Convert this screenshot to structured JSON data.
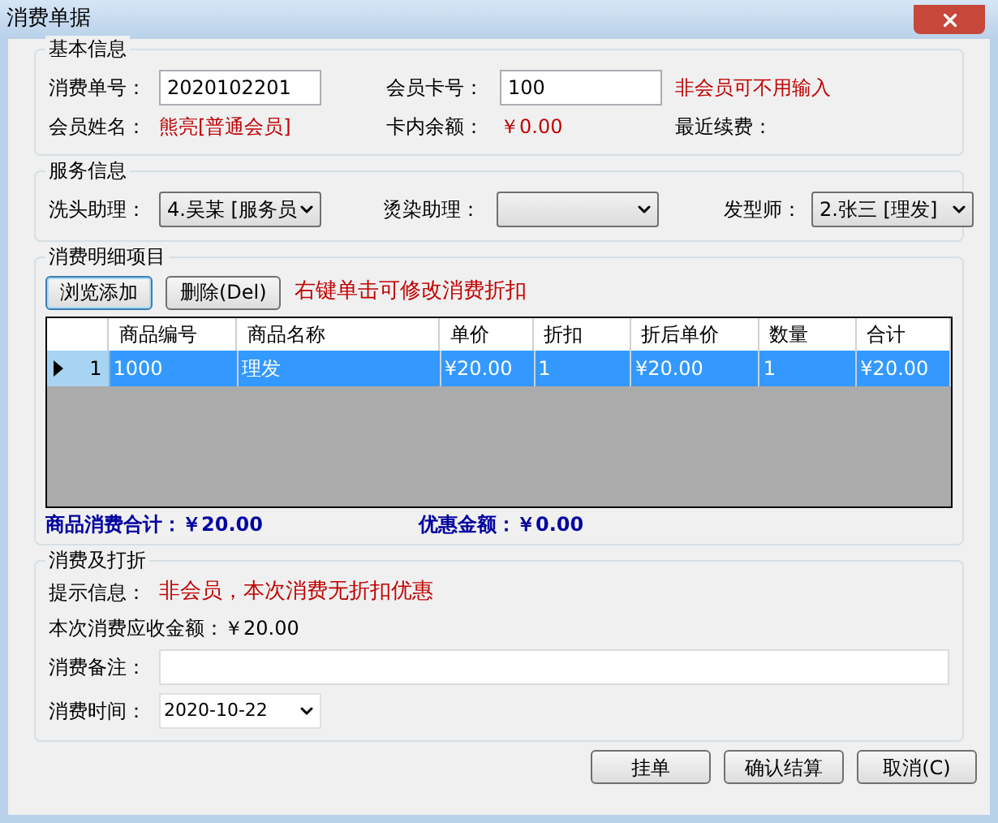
{
  "window": {
    "title": "消费单据"
  },
  "basic_info": {
    "title": "基本信息",
    "order_no": {
      "label": "消费单号：",
      "value": "2020102201"
    },
    "card_no": {
      "label": "会员卡号：",
      "value": "100"
    },
    "card_hint": "非会员可不用输入",
    "member_name": {
      "label": "会员姓名：",
      "value": "熊亮[普通会员]"
    },
    "balance": {
      "label": "卡内余额：",
      "value": "￥0.00"
    },
    "recent_renewal": {
      "label": "最近续费："
    }
  },
  "service_info": {
    "title": "服务信息",
    "selects": [
      {
        "label": "洗头助理：",
        "value": "4.吴某 [服务员"
      },
      {
        "label": "烫染助理："
      },
      {
        "label": "发型师：",
        "value": "2.张三 [理发]"
      }
    ]
  },
  "details": {
    "title": "消费明细项目",
    "buttons": [
      {
        "label": "浏览添加",
        "focused": true
      },
      {
        "label": "删除(Del)",
        "focused": false
      }
    ],
    "hint": "右键单击可修改消费折扣",
    "columns": [
      "商品编号",
      "商品名称",
      "单价",
      "折扣",
      "折后单价",
      "数量",
      "合计"
    ],
    "rows": [
      {
        "index": "1",
        "selected": true,
        "cells": [
          "1000",
          "理发",
          "¥20.00",
          "1",
          "¥20.00",
          "1",
          "¥20.00"
        ]
      }
    ],
    "total": {
      "label": "商品消费合计：",
      "value": "￥20.00"
    },
    "discount": {
      "label": "优惠金额：",
      "value": "￥0.00"
    }
  },
  "payment": {
    "title": "消费及打折",
    "notice": {
      "label": "提示信息：",
      "value": "非会员，本次消费无折扣优惠"
    },
    "amount_due": "本次消费应收金额：￥20.00",
    "note": {
      "label": "消费备注："
    },
    "time": {
      "label": "消费时间：",
      "value": "2020-10-22"
    }
  },
  "footer_buttons": [
    "挂单",
    "确认结算",
    "取消(C)"
  ]
}
